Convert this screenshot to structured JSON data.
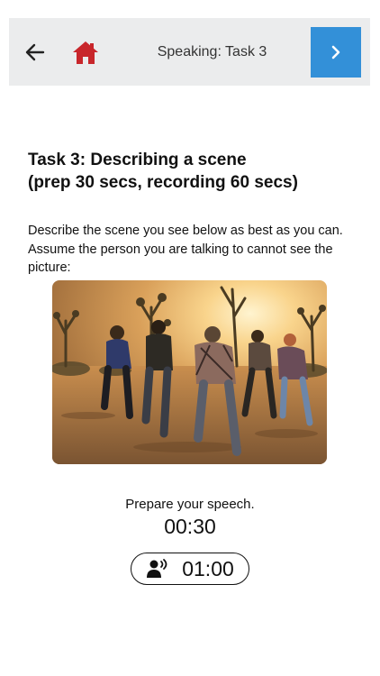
{
  "header": {
    "title": "Speaking: Task 3",
    "back_icon": "arrow-left-icon",
    "home_icon": "home-icon",
    "next_icon": "chevron-right-icon",
    "colors": {
      "bar_bg": "#ebeced",
      "home": "#c8262b",
      "next_bg": "#3390d8"
    }
  },
  "task": {
    "title_line1": "Task 3: Describing a scene",
    "title_line2": "(prep 30 secs, recording 60 secs)",
    "instructions": "Describe the scene you see below as best as you can. Assume the person you are talking to cannot see the picture:"
  },
  "scene": {
    "alt": "A group of people running across a desert landscape with Joshua trees at sunset"
  },
  "timer": {
    "prepare_label": "Prepare your speech.",
    "prep_time": "00:30",
    "record_icon": "speaking-person-icon",
    "record_time": "01:00"
  }
}
